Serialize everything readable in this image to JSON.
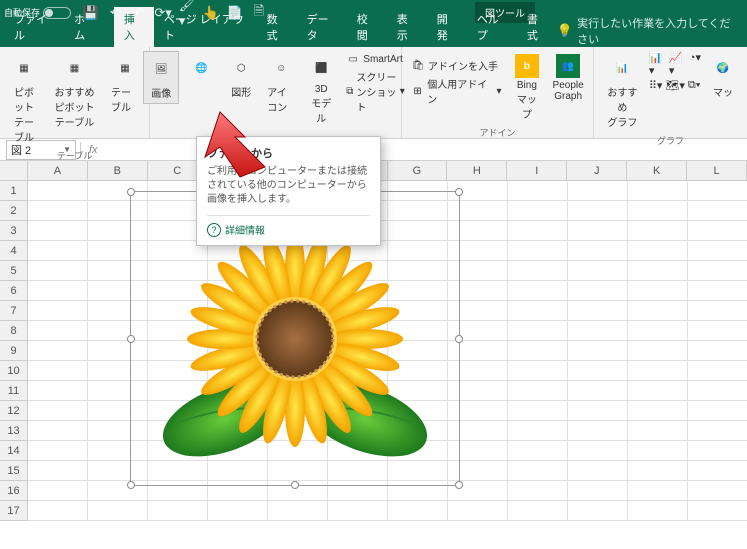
{
  "titlebar": {
    "auto_save": "自動保存",
    "tools_label": "図ツール"
  },
  "qat_icons": [
    "save-icon",
    "reset-icon",
    "undo-icon",
    "redo-icon",
    "brush-icon",
    "touch-icon",
    "pdf-icon",
    "preview-icon"
  ],
  "tabs": [
    "ファイル",
    "ホーム",
    "挿入",
    "ページ レイアウト",
    "数式",
    "データ",
    "校閲",
    "表示",
    "開発",
    "ヘルプ",
    "書式"
  ],
  "active_tab": "挿入",
  "format_tab": "書式",
  "search_hint": "実行したい作業を入力してください",
  "ribbon": {
    "group_tables": {
      "label": "テーブル",
      "pivot": "ピボット\nテーブル",
      "recommended": "おすすめ\nピボットテーブル",
      "table": "テーブル"
    },
    "group_illust": {
      "image": "画像",
      "shapes": "図形",
      "icons": "アイコン",
      "model3d": "3D\nモデル",
      "smartart": "SmartArt",
      "screenshot": "スクリーンショット"
    },
    "group_addins": {
      "label": "アドイン",
      "get": "アドインを入手",
      "my": "個人用アドイン",
      "bing": "Bing\nマップ",
      "people": "People\nGraph"
    },
    "group_charts": {
      "label": "グラフ",
      "recommended": "おすすめ\nグラフ",
      "map": "マッ"
    }
  },
  "tooltip": {
    "title": "ファイルから",
    "desc": "ご利用のコンピューターまたは接続されている他のコンピューターから画像を挿入します。",
    "link": "詳細情報"
  },
  "namebox": "図 2",
  "columns": [
    "A",
    "B",
    "C",
    "D",
    "E",
    "F",
    "G",
    "H",
    "I",
    "J",
    "K",
    "L"
  ],
  "rows": [
    1,
    2,
    3,
    4,
    5,
    6,
    7,
    8,
    9,
    10,
    11,
    12,
    13,
    14,
    15,
    16,
    17
  ]
}
